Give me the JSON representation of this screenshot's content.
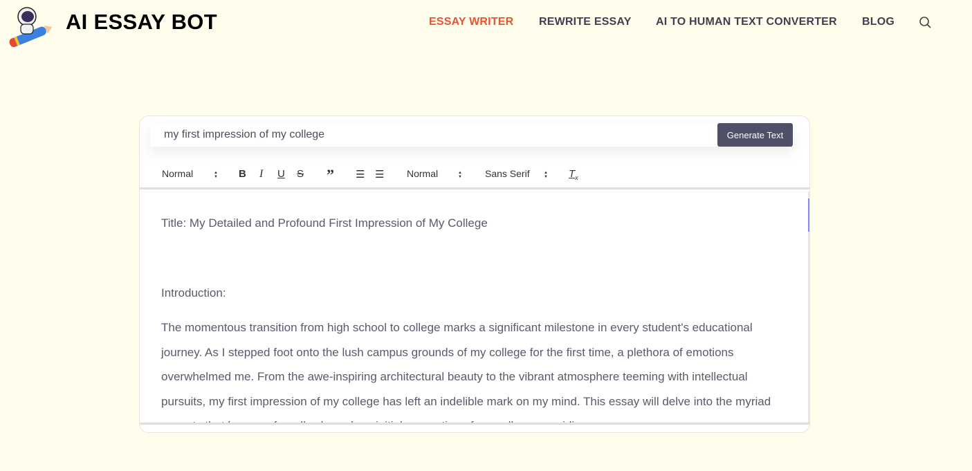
{
  "brand": {
    "name": "AI ESSAY BOT"
  },
  "nav": {
    "items": [
      {
        "label": "ESSAY WRITER",
        "active": true
      },
      {
        "label": "REWRITE ESSAY"
      },
      {
        "label": "AI TO HUMAN TEXT CONVERTER"
      },
      {
        "label": "BLOG"
      }
    ],
    "accent": "#ea5330"
  },
  "prompt": {
    "value": "my first impression of my college",
    "button": "Generate Text"
  },
  "toolbar": {
    "header": "Normal",
    "size": "Normal",
    "font": "Sans Serif"
  },
  "editor": {
    "paragraphs": [
      "Title: My Detailed and Profound First Impression of My College",
      "",
      "Introduction:",
      "The momentous transition from high school to college marks a significant milestone in every student's educational journey. As I stepped foot onto the lush campus grounds of my college for the first time, a plethora of emotions overwhelmed me. From the awe-inspiring architectural beauty to the vibrant atmosphere teeming with intellectual pursuits, my first impression of my college has left an indelible mark on my mind. This essay will delve into the myriad aspects that have profoundly shaped my initial perception of my college, providing"
    ]
  }
}
